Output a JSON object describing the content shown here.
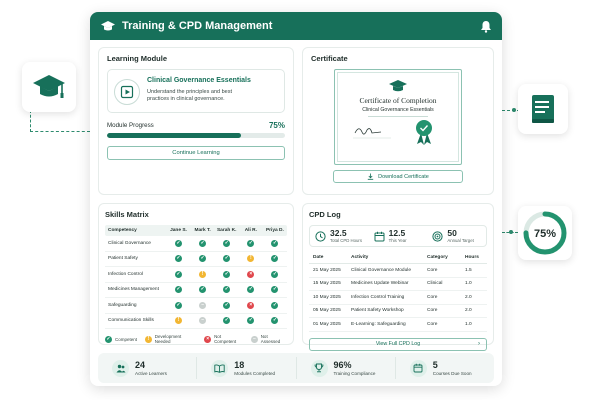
{
  "app": {
    "title": "Training & CPD Management"
  },
  "learning_module": {
    "heading": "Learning Module",
    "course_name": "Clinical Governance Essentials",
    "description": "Understand the principles and best practices in clinical governance.",
    "progress_label": "Module Progress",
    "progress_pct_text": "75%",
    "progress_fraction": 0.75,
    "continue_label": "Continue Learning"
  },
  "certificate": {
    "heading": "Certificate",
    "title": "Certificate of Completion",
    "course": "Clinical Governance Essentials",
    "download_label": "Download Certificate"
  },
  "skills_matrix": {
    "heading": "Skills Matrix",
    "column_competency": "Competency",
    "people": [
      "Jane S.",
      "Mark T.",
      "Sarah K.",
      "Ali R.",
      "Priya D."
    ],
    "rows": [
      {
        "competency": "Clinical Governance",
        "status": [
          "c",
          "c",
          "c",
          "c",
          "c"
        ]
      },
      {
        "competency": "Patient Safety",
        "status": [
          "c",
          "c",
          "c",
          "d",
          "c"
        ]
      },
      {
        "competency": "Infection Control",
        "status": [
          "c",
          "d",
          "c",
          "n",
          "c"
        ]
      },
      {
        "competency": "Medicines Management",
        "status": [
          "c",
          "c",
          "c",
          "c",
          "c"
        ]
      },
      {
        "competency": "Safeguarding",
        "status": [
          "c",
          "a",
          "c",
          "n",
          "c"
        ]
      },
      {
        "competency": "Communication Skills",
        "status": [
          "d",
          "a",
          "c",
          "c",
          "c"
        ]
      }
    ],
    "legend": {
      "competent": "Competent",
      "development": "Development Needed",
      "not_competent": "Not Competent",
      "not_assessed": "Not Assessed"
    },
    "colors": {
      "c": "#23936f",
      "d": "#f2b632",
      "n": "#e0474c",
      "a": "#c9d0ce"
    }
  },
  "cpd_log": {
    "heading": "CPD Log",
    "stats": [
      {
        "value": "32.5",
        "label": "Total CPD Hours",
        "icon": "clock-icon"
      },
      {
        "value": "12.5",
        "label": "This Year",
        "icon": "calendar-icon"
      },
      {
        "value": "50",
        "label": "Annual Target",
        "icon": "target-icon"
      }
    ],
    "columns": [
      "Date",
      "Activity",
      "Category",
      "Hours"
    ],
    "entries": [
      {
        "date": "21 May 2025",
        "activity": "Clinical Governance Module",
        "category": "Core",
        "hours": "1.5"
      },
      {
        "date": "15 May 2025",
        "activity": "Medicines Update Webinar",
        "category": "Clinical",
        "hours": "1.0"
      },
      {
        "date": "10 May 2025",
        "activity": "Infection Control Training",
        "category": "Core",
        "hours": "2.0"
      },
      {
        "date": "05 May 2025",
        "activity": "Patient Safety Workshop",
        "category": "Core",
        "hours": "2.0"
      },
      {
        "date": "01 May 2025",
        "activity": "E-Learning: Safeguarding",
        "category": "Core",
        "hours": "1.0"
      }
    ],
    "view_full_label": "View Full CPD Log",
    "arrow": "›"
  },
  "summary": [
    {
      "value": "24",
      "label": "Active Learners",
      "icon": "users-icon"
    },
    {
      "value": "18",
      "label": "Modules Completed",
      "icon": "book-open-icon"
    },
    {
      "value": "96%",
      "label": "Training Compliance",
      "icon": "trophy-icon"
    },
    {
      "value": "5",
      "label": "Courses Due Soon",
      "icon": "calendar-icon"
    }
  ],
  "side_widget": {
    "ring_text": "75%",
    "ring_fraction": 0.75
  },
  "brand_colors": {
    "primary": "#17705a",
    "accent": "#23936f"
  }
}
